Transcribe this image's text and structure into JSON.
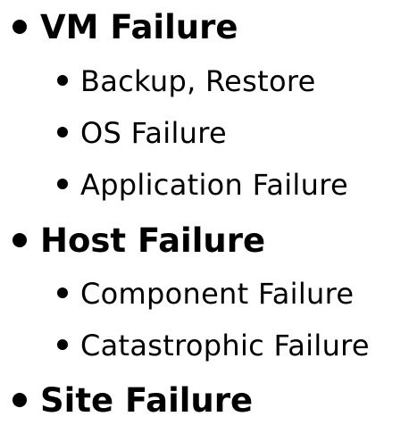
{
  "outline": [
    {
      "title": "VM Failure",
      "children": [
        "Backup, Restore",
        "OS Failure",
        "Application Failure"
      ]
    },
    {
      "title": "Host Failure",
      "children": [
        "Component Failure",
        "Catastrophic Failure"
      ]
    },
    {
      "title": "Site Failure",
      "children": []
    }
  ]
}
